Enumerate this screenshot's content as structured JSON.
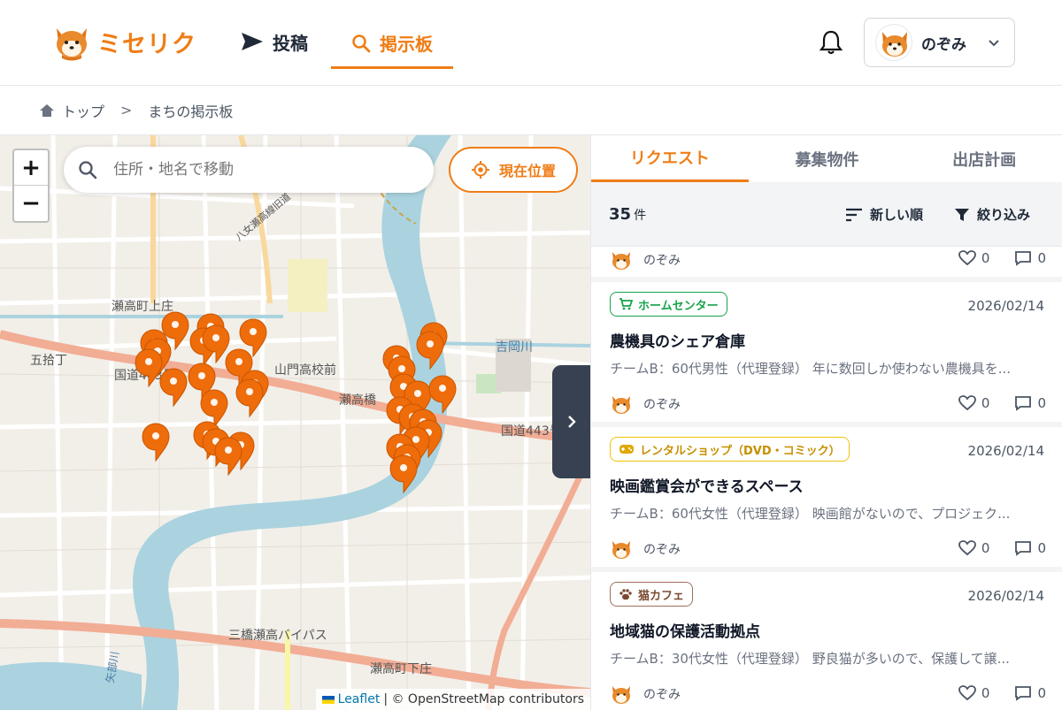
{
  "header": {
    "logo_text": "ミセリク",
    "nav": [
      {
        "label": "投稿",
        "icon": "send-icon"
      },
      {
        "label": "掲示板",
        "icon": "search-icon"
      }
    ],
    "user_name": "のぞみ"
  },
  "breadcrumb": {
    "home": "トップ",
    "separator": ">",
    "current": "まちの掲示板"
  },
  "map": {
    "search_placeholder": "住所・地名で移動",
    "locate_label": "現在位置",
    "zoom_in": "+",
    "zoom_out": "−",
    "attribution_leaflet": "Leaflet",
    "attribution_rest": "| © OpenStreetMap contributors",
    "labels": [
      "瀬高町上庄",
      "五拾丁",
      "国道443号",
      "山門高校前",
      "瀬高橋",
      "吉岡川",
      "国道443号",
      "三橋瀬高バイパス",
      "瀬高町下庄",
      "八女瀬高線旧道",
      "矢部川"
    ]
  },
  "panel": {
    "tabs": [
      "リクエスト",
      "募集物件",
      "出店計画"
    ],
    "count": "35",
    "count_unit": "件",
    "sort_label": "新しい順",
    "filter_label": "絞り込み",
    "partial_row": {
      "author": "のぞみ",
      "likes": "0",
      "comments": "0"
    },
    "cards": [
      {
        "badge": "ホームセンター",
        "badge_icon": "cart-icon",
        "badge_color": "#16a34a",
        "date": "2026/02/14",
        "title": "農機具のシェア倉庫",
        "desc": "チームB：60代男性（代理登録） 年に数回しか使わない農機具を...",
        "author": "のぞみ",
        "likes": "0",
        "comments": "0"
      },
      {
        "badge": "レンタルショップ（DVD・コミック）",
        "badge_icon": "gamepad-icon",
        "badge_color": "#d4a017",
        "date": "2026/02/14",
        "title": "映画鑑賞会ができるスペース",
        "desc": "チームB：60代女性（代理登録） 映画館がないので、プロジェク...",
        "author": "のぞみ",
        "likes": "0",
        "comments": "0"
      },
      {
        "badge": "猫カフェ",
        "badge_icon": "paw-icon",
        "badge_color": "#8b5a3c",
        "date": "2026/02/14",
        "title": "地域猫の保護活動拠点",
        "desc": "チームB：30代女性（代理登録） 野良猫が多いので、保護して譲...",
        "author": "のぞみ",
        "likes": "0",
        "comments": "0"
      }
    ]
  },
  "colors": {
    "accent": "#ef7d16",
    "dark": "#374151"
  }
}
